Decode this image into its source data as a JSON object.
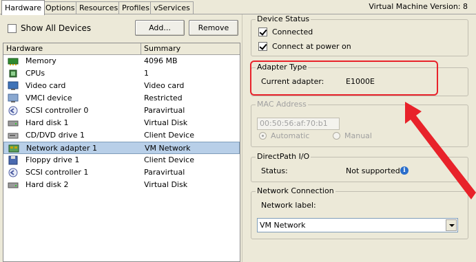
{
  "tabs": [
    {
      "label": "Hardware",
      "active": true
    },
    {
      "label": "Options",
      "active": false
    },
    {
      "label": "Resources",
      "active": false
    },
    {
      "label": "Profiles",
      "active": false
    },
    {
      "label": "vServices",
      "active": false
    }
  ],
  "vm_version": "Virtual Machine Version: 8",
  "show_all_devices": {
    "label": "Show All Devices",
    "checked": false
  },
  "buttons": {
    "add": "Add...",
    "remove": "Remove"
  },
  "hardware_table": {
    "columns": [
      "Hardware",
      "Summary"
    ],
    "rows": [
      {
        "icon": "memory-icon",
        "name": "Memory",
        "summary": "4096 MB"
      },
      {
        "icon": "cpu-icon",
        "name": "CPUs",
        "summary": "1"
      },
      {
        "icon": "video-card-icon",
        "name": "Video card",
        "summary": "Video card"
      },
      {
        "icon": "vmci-device-icon",
        "name": "VMCI device",
        "summary": "Restricted"
      },
      {
        "icon": "scsi-controller-icon",
        "name": "SCSI controller 0",
        "summary": "Paravirtual"
      },
      {
        "icon": "hard-disk-icon",
        "name": "Hard disk 1",
        "summary": "Virtual Disk"
      },
      {
        "icon": "cd-dvd-icon",
        "name": "CD/DVD drive 1",
        "summary": "Client Device"
      },
      {
        "icon": "network-adapter-icon",
        "name": "Network adapter 1",
        "summary": "VM Network",
        "selected": true
      },
      {
        "icon": "floppy-icon",
        "name": "Floppy drive 1",
        "summary": "Client Device"
      },
      {
        "icon": "scsi-controller-icon",
        "name": "SCSI controller 1",
        "summary": "Paravirtual"
      },
      {
        "icon": "hard-disk-icon",
        "name": "Hard disk 2",
        "summary": "Virtual Disk"
      }
    ]
  },
  "device_status": {
    "title": "Device Status",
    "connected": {
      "label": "Connected",
      "checked": true
    },
    "connect_at_power_on": {
      "label": "Connect at power on",
      "checked": true
    }
  },
  "adapter_type": {
    "title": "Adapter Type",
    "current_label": "Current adapter:",
    "current_value": "E1000E"
  },
  "mac_address": {
    "title": "MAC Address",
    "value": "00:50:56:af:70:b1",
    "automatic": "Automatic",
    "manual": "Manual",
    "selected": "Automatic"
  },
  "directpath": {
    "title": "DirectPath I/O",
    "status_label": "Status:",
    "status_value": "Not supported"
  },
  "network_connection": {
    "title": "Network Connection",
    "label": "Network label:",
    "value": "VM Network"
  },
  "colors": {
    "annotation": "#e8222a",
    "selection": "#b8cfe8",
    "info": "#2a6ecb"
  }
}
